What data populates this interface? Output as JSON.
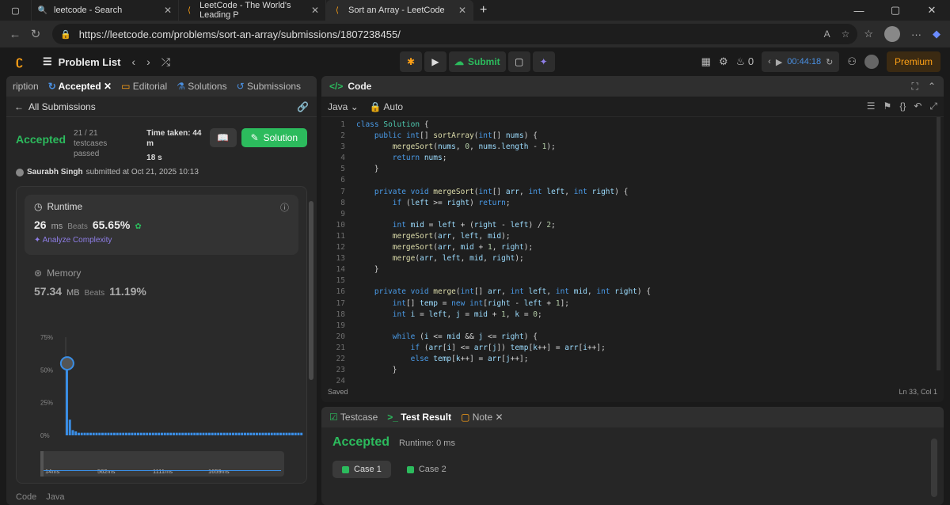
{
  "browser": {
    "tabs": [
      {
        "title": "leetcode - Search",
        "icon": "search-icon"
      },
      {
        "title": "LeetCode - The World's Leading P",
        "icon": "leetcode-icon"
      },
      {
        "title": "Sort an Array - LeetCode",
        "icon": "leetcode-icon",
        "active": true
      }
    ],
    "url": "https://leetcode.com/problems/sort-an-array/submissions/1807238455/"
  },
  "nav": {
    "problem_list": "Problem List",
    "submit": "Submit",
    "timer": "00:44:18",
    "streak": "0",
    "premium": "Premium"
  },
  "left": {
    "tabs": [
      "ription",
      "Accepted",
      "Editorial",
      "Solutions",
      "Submissions"
    ],
    "all_submissions": "All Submissions",
    "status": "Accepted",
    "testcases": "21 / 21 testcases",
    "testcases2": "passed",
    "time_taken_label": "Time taken: 44 m",
    "time_taken_sec": "18 s",
    "solution_btn": "Solution",
    "user": "Saurabh Singh",
    "submitted_at": "submitted at Oct 21, 2025 10:13",
    "runtime_label": "Runtime",
    "runtime_value": "26",
    "runtime_unit": "ms",
    "beats_label": "Beats",
    "runtime_beats": "65.65%",
    "analyze": "Analyze Complexity",
    "memory_label": "Memory",
    "memory_value": "57.34",
    "memory_unit": "MB",
    "memory_beats": "11.19%",
    "footer_code": "Code",
    "footer_lang": "Java"
  },
  "chart_data": {
    "type": "bar",
    "yticks": [
      "75%",
      "50%",
      "25%",
      "0%"
    ],
    "xticks": [
      "14ms",
      "562ms",
      "1111ms",
      "1659ms"
    ],
    "ylim": [
      0,
      75
    ],
    "highlight_value": 55,
    "values": [
      55,
      12,
      4,
      3,
      2,
      2,
      2,
      2,
      2,
      2,
      2,
      2,
      2,
      2,
      2,
      2,
      2,
      2,
      2,
      2,
      2,
      2,
      2,
      2,
      2,
      2,
      2,
      2,
      2,
      2,
      2,
      2,
      2,
      2,
      2,
      2,
      2,
      2,
      2,
      2,
      2,
      2,
      2,
      2,
      2,
      2,
      2,
      2,
      2,
      2,
      2,
      2,
      2,
      2,
      2,
      2,
      2,
      2,
      2,
      2,
      2,
      2,
      2,
      2,
      2,
      2,
      2,
      2,
      2,
      2,
      2,
      2,
      2,
      2,
      2,
      2,
      2,
      2,
      2,
      2
    ]
  },
  "editor": {
    "title": "Code",
    "lang": "Java",
    "mode": "Auto",
    "saved": "Saved",
    "cursor": "Ln 33, Col 1",
    "lines": [
      "class Solution {",
      "    public int[] sortArray(int[] nums) {",
      "        mergeSort(nums, 0, nums.length - 1);",
      "        return nums;",
      "    }",
      "",
      "    private void mergeSort(int[] arr, int left, int right) {",
      "        if (left >= right) return;",
      "",
      "        int mid = left + (right - left) / 2;",
      "        mergeSort(arr, left, mid);",
      "        mergeSort(arr, mid + 1, right);",
      "        merge(arr, left, mid, right);",
      "    }",
      "",
      "    private void merge(int[] arr, int left, int mid, int right) {",
      "        int[] temp = new int[right - left + 1];",
      "        int i = left, j = mid + 1, k = 0;",
      "",
      "        while (i <= mid && j <= right) {",
      "            if (arr[i] <= arr[j]) temp[k++] = arr[i++];",
      "            else temp[k++] = arr[j++];",
      "        }",
      ""
    ]
  },
  "result": {
    "tabs": [
      "Testcase",
      "Test Result",
      "Note"
    ],
    "status": "Accepted",
    "runtime": "Runtime: 0 ms",
    "cases": [
      "Case 1",
      "Case 2"
    ]
  }
}
